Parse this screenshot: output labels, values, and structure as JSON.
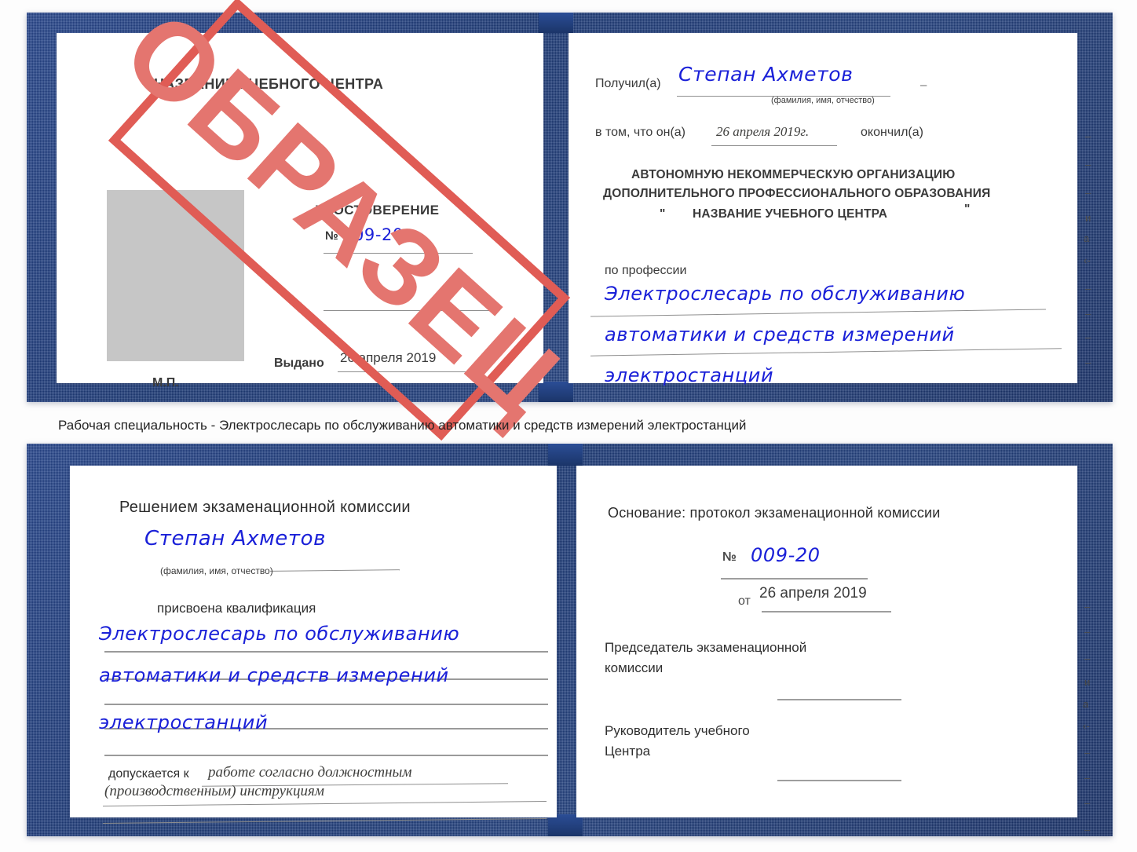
{
  "caption": {
    "text": "Рабочая специальность - Электрослесарь по обслуживанию автоматики и средств измерений электростанций"
  },
  "stamp": {
    "text": "ОБРАЗЕЦ",
    "color": "#e4756f",
    "border_color": "#e05c55"
  },
  "certificate_top": {
    "left_page": {
      "header": "НАЗВАНИЕ УЧЕБНОГО ЦЕНТРА",
      "title": "УДОСТОВЕРЕНИЕ",
      "number_label": "№",
      "number_value": "009-20",
      "issued_label": "Выдано",
      "issued_value": "26 апреля 2019",
      "seal_label": "М.П."
    },
    "right_page": {
      "received_label": "Получил(а)",
      "received_value": "Степан Ахметов",
      "name_hint": "(фамилия, имя, отчество)",
      "in_that_label": "в том, что он(а)",
      "completion_date": "26 апреля 2019г.",
      "finished_label": "окончил(а)",
      "org_line1": "АВТОНОМНУЮ НЕКОММЕРЧЕСКУЮ ОРГАНИЗАЦИЮ",
      "org_line2": "ДОПОЛНИТЕЛЬНОГО ПРОФЕССИОНАЛЬНОГО ОБРАЗОВАНИЯ",
      "org_quote_open": "\"",
      "org_line3": "НАЗВАНИЕ УЧЕБНОГО ЦЕНТРА",
      "org_quote_close": "\"",
      "profession_label": "по профессии",
      "profession_line1": "Электрослесарь по обслуживанию",
      "profession_line2": "автоматики и средств измерений",
      "profession_line3": "электростанций",
      "edge_glyphs": [
        "–",
        "–",
        "–",
        "и",
        "а",
        "‹-",
        "–",
        "–",
        "–",
        "–"
      ]
    }
  },
  "certificate_bottom": {
    "left_page": {
      "header": "Решением экзаменационной комиссии",
      "name_value": "Степан Ахметов",
      "name_hint": "(фамилия, имя, отчество)",
      "qualification_label": "присвоена квалификация",
      "qualification_line1": "Электрослесарь по обслуживанию",
      "qualification_line2": "автоматики и средств измерений",
      "qualification_line3": "электростанций",
      "allowed_label": "допускается к",
      "allowed_line1": "работе согласно должностным",
      "allowed_line2": "(производственным) инструкциям"
    },
    "right_page": {
      "basis_label": "Основание: протокол экзаменационной комиссии",
      "number_label": "№",
      "number_value": "009-20",
      "date_label": "от",
      "date_value": "26 апреля 2019",
      "chairman_line1": "Председатель экзаменационной",
      "chairman_line2": "комиссии",
      "head_line1": "Руководитель учебного",
      "head_line2": "Центра",
      "edge_glyphs": [
        "–",
        "–",
        "–",
        "и",
        "а",
        "‹-",
        "–",
        "–",
        "–",
        "–"
      ]
    }
  }
}
